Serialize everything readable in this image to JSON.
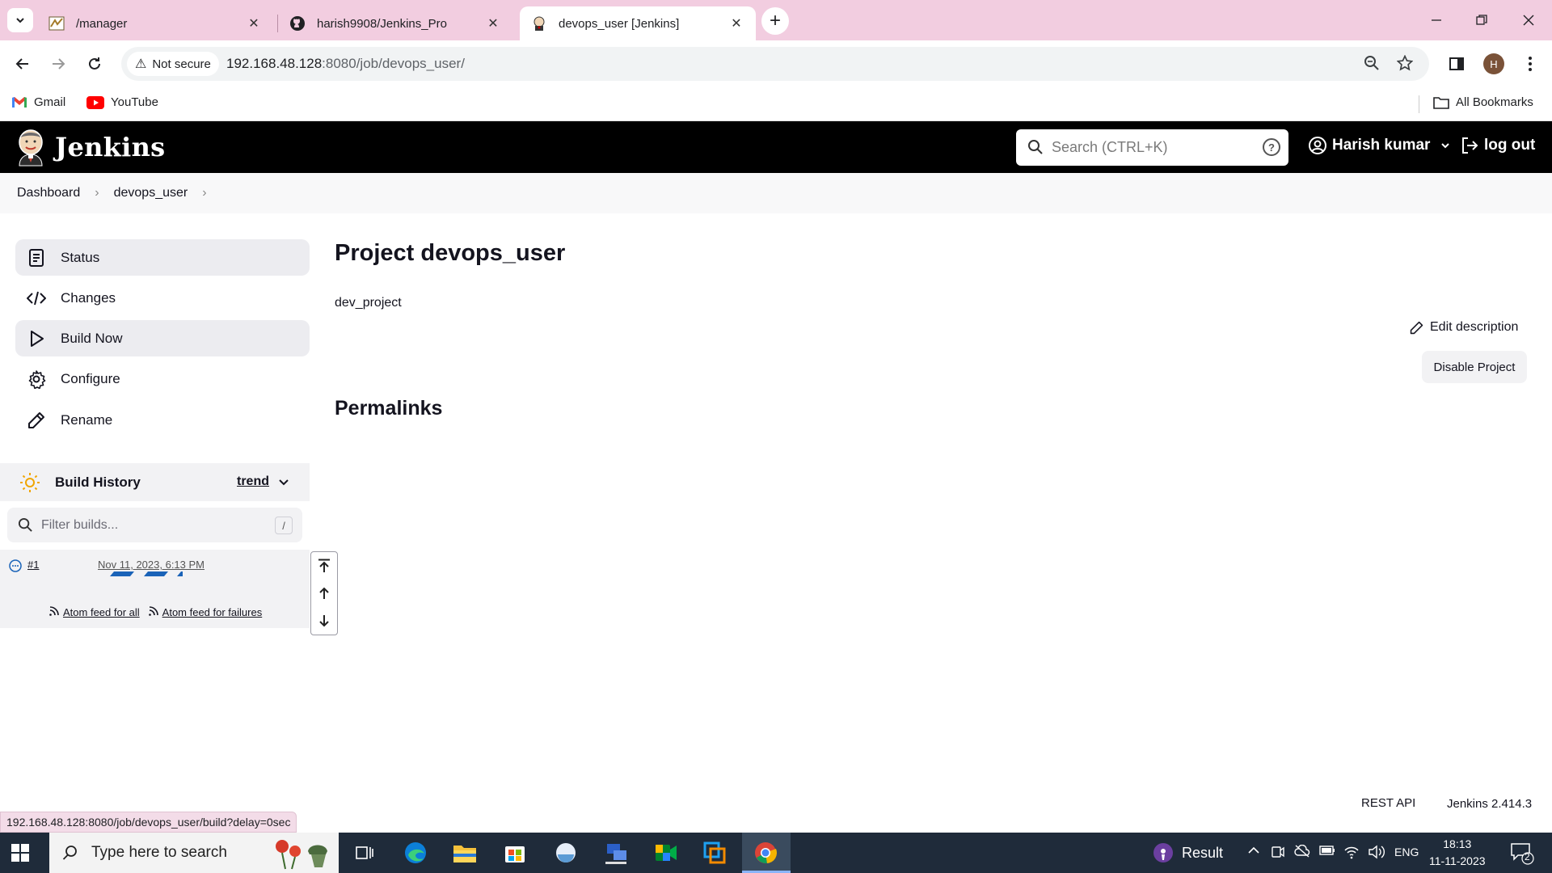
{
  "browser": {
    "tabs": [
      {
        "title": "/manager",
        "active": false
      },
      {
        "title": "harish9908/Jenkins_Pro",
        "active": false
      },
      {
        "title": "devops_user [Jenkins]",
        "active": true
      }
    ],
    "security_label": "Not secure",
    "url_host": "192.168.48.128",
    "url_rest": ":8080/job/devops_user/",
    "profile_initial": "H",
    "bookmarks": [
      {
        "label": "Gmail",
        "icon": "gmail-icon"
      },
      {
        "label": "YouTube",
        "icon": "youtube-icon"
      }
    ],
    "all_bookmarks": "All Bookmarks",
    "status_url": "192.168.48.128:8080/job/devops_user/build?delay=0sec"
  },
  "jenkins": {
    "brand": "Jenkins",
    "search_placeholder": "Search (CTRL+K)",
    "user": "Harish kumar",
    "logout": "log out",
    "breadcrumb": [
      "Dashboard",
      "devops_user"
    ],
    "side_menu": [
      {
        "label": "Status",
        "icon": "status-icon"
      },
      {
        "label": "Changes",
        "icon": "code-icon"
      },
      {
        "label": "Build Now",
        "icon": "play-icon"
      },
      {
        "label": "Configure",
        "icon": "gear-icon"
      },
      {
        "label": "Rename",
        "icon": "pencil-icon"
      }
    ],
    "build_history": {
      "title": "Build History",
      "trend": "trend",
      "filter_placeholder": "Filter builds...",
      "filter_shortcut": "/",
      "builds": [
        {
          "number": "#1",
          "date": "Nov 11, 2023, 6:13 PM",
          "status": "in-progress"
        }
      ],
      "feed_all": "Atom feed for all",
      "feed_failures": "Atom feed for failures"
    },
    "project_title": "Project devops_user",
    "project_description": "dev_project",
    "edit_description": "Edit description",
    "disable_project": "Disable Project",
    "permalinks": "Permalinks",
    "rest_api": "REST API",
    "version": "Jenkins 2.414.3"
  },
  "taskbar": {
    "search_placeholder": "Type here to search",
    "result_label": "Result",
    "language": "ENG",
    "time": "18:13",
    "date": "11-11-2023",
    "notification_count": "2"
  }
}
